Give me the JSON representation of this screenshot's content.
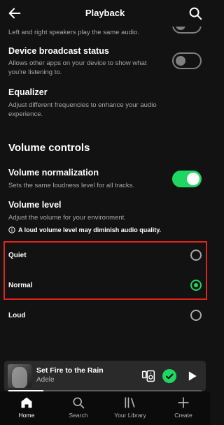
{
  "header": {
    "title": "Playback"
  },
  "settings": {
    "mono_desc": "Left and right speakers play the same audio.",
    "broadcast": {
      "title": "Device broadcast status",
      "desc": "Allows other apps on your device to show what you're listening to.",
      "on": false
    },
    "equalizer": {
      "title": "Equalizer",
      "desc": "Adjust different frequencies to enhance your audio experience."
    }
  },
  "volume": {
    "section_title": "Volume controls",
    "normalization": {
      "title": "Volume normalization",
      "desc": "Sets the same loudness level for all tracks.",
      "on": true
    },
    "level": {
      "title": "Volume level",
      "desc": "Adjust the volume for your environment.",
      "warning": "A loud volume level may diminish audio quality."
    },
    "options": [
      {
        "label": "Quiet",
        "selected": false
      },
      {
        "label": "Normal",
        "selected": true
      },
      {
        "label": "Loud",
        "selected": false
      }
    ]
  },
  "player": {
    "song": "Set Fire to the Rain",
    "artist": "Adele",
    "progress": 0.18
  },
  "nav": {
    "items": [
      {
        "label": "Home",
        "icon": "home-icon",
        "active": true
      },
      {
        "label": "Search",
        "icon": "search-icon",
        "active": false
      },
      {
        "label": "Your Library",
        "icon": "library-icon",
        "active": false
      },
      {
        "label": "Create",
        "icon": "plus-icon",
        "active": false
      }
    ]
  },
  "colors": {
    "accent": "#1ed760",
    "highlight": "#e0241b",
    "background": "#121212"
  }
}
